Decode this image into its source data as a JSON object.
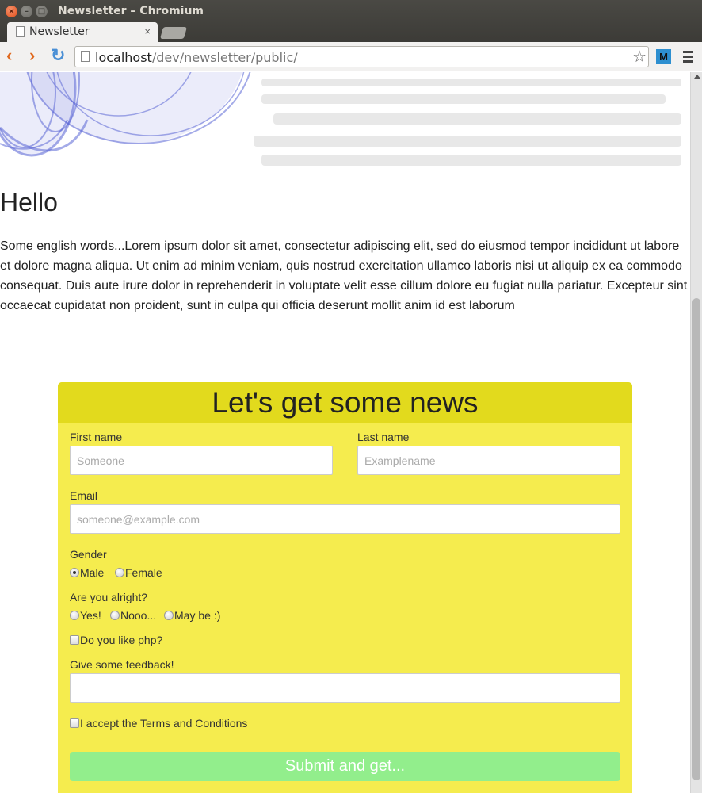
{
  "window": {
    "title": "Newsletter – Chromium"
  },
  "tab": {
    "label": "Newsletter",
    "close": "×"
  },
  "address": {
    "host": "localhost",
    "path": "/dev/newsletter/public/"
  },
  "extension": {
    "label": "M"
  },
  "page": {
    "heading": "Hello",
    "intro": "Some english words...Lorem ipsum dolor sit amet, consectetur adipiscing elit, sed do eiusmod tempor incididunt ut labore et dolore magna aliqua. Ut enim ad minim veniam, quis nostrud exercitation ullamco laboris nisi ut aliquip ex ea commodo consequat. Duis aute irure dolor in reprehenderit in voluptate velit esse cillum dolore eu fugiat nulla pariatur. Excepteur sint occaecat cupidatat non proident, sunt in culpa qui officia deserunt mollit anim id est laborum"
  },
  "form": {
    "title": "Let's get some news",
    "first_name": {
      "label": "First name",
      "placeholder": "Someone",
      "value": ""
    },
    "last_name": {
      "label": "Last name",
      "placeholder": "Examplename",
      "value": ""
    },
    "email": {
      "label": "Email",
      "placeholder": "someone@example.com",
      "value": ""
    },
    "gender": {
      "label": "Gender",
      "options": [
        "Male",
        "Female"
      ],
      "selected": "Male"
    },
    "alright": {
      "label": "Are you alright?",
      "options": [
        "Yes!",
        "Nooo...",
        "May be :)"
      ],
      "selected": ""
    },
    "php": {
      "label": "Do you like php?",
      "checked": false
    },
    "feedback": {
      "label": "Give some feedback!",
      "value": ""
    },
    "terms": {
      "label": "I accept the Terms and Conditions",
      "checked": false
    },
    "submit_label": "Submit and get..."
  },
  "colors": {
    "form_bg": "#f5ec4e",
    "form_header_bg": "#e2da1d",
    "submit_bg": "#92ee8c"
  }
}
